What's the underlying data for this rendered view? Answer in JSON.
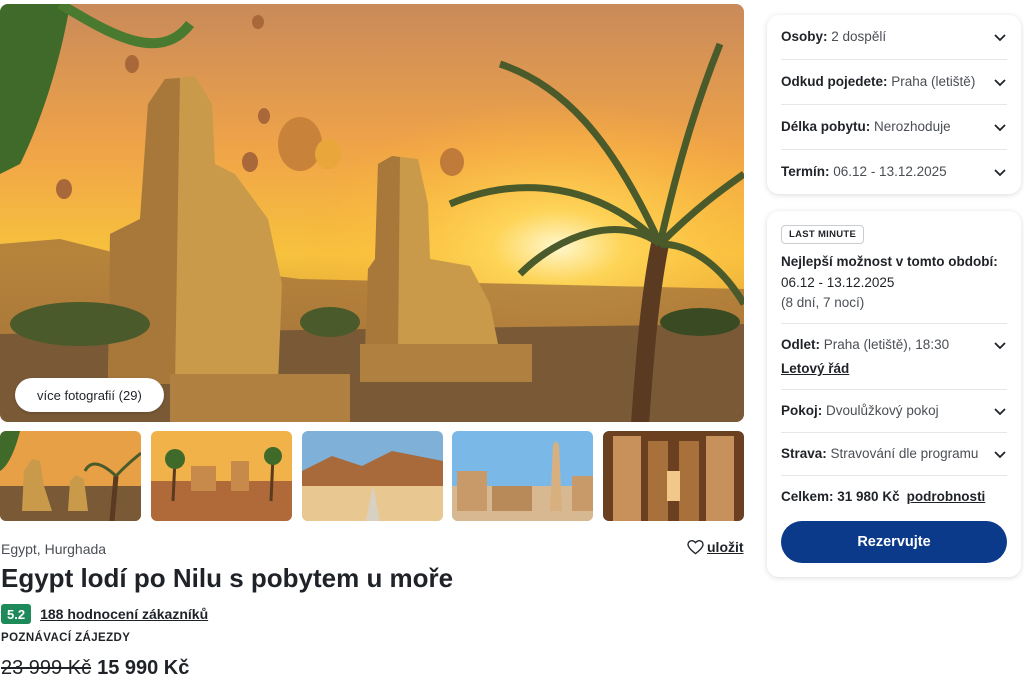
{
  "gallery": {
    "more_photos_label": "více fotografií (29)",
    "thumbnails": [
      "colossi-sunset",
      "ruins-palms",
      "desert-road",
      "obelisk-temple",
      "temple-interior"
    ]
  },
  "product": {
    "location": "Egypt, Hurghada",
    "save_label": "uložit",
    "title": "Egypt lodí po Nilu s pobytem u moře",
    "rating_score": "5.2",
    "rating_count_label": "188 hodnocení zákazníků",
    "category": "POZNÁVACÍ ZÁJEZDY",
    "old_price": "23 999 Kč",
    "new_price": "15 990 Kč"
  },
  "filters": [
    {
      "label": "Osoby:",
      "value": "2 dospělí"
    },
    {
      "label": "Odkud pojedete:",
      "value": "Praha (letiště)"
    },
    {
      "label": "Délka pobytu:",
      "value": "Nerozhoduje"
    },
    {
      "label": "Termín:",
      "value": "06.12 - 13.12.2025"
    }
  ],
  "offer": {
    "badge": "LAST MINUTE",
    "best_title": "Nejlepší možnost v tomto období:",
    "best_dates": "06.12 - 13.12.2025",
    "best_nights": "(8 dní, 7 nocí)",
    "flight_label": "Odlet:",
    "flight_value": "Praha (letiště), 18:30",
    "flight_schedule_link": "Letový řád",
    "room_label": "Pokoj:",
    "room_value": "Dvoulůžkový pokoj",
    "board_label": "Strava:",
    "board_value": "Stravování dle programu",
    "total_label": "Celkem: 31 980 Kč",
    "details_link": "podrobnosti",
    "reserve_label": "Rezervujte"
  },
  "colors": {
    "primary_button": "#0b3a8a",
    "rating_badge": "#1e8a5a"
  },
  "icons": [
    "heart-icon",
    "chevron-down-icon"
  ]
}
